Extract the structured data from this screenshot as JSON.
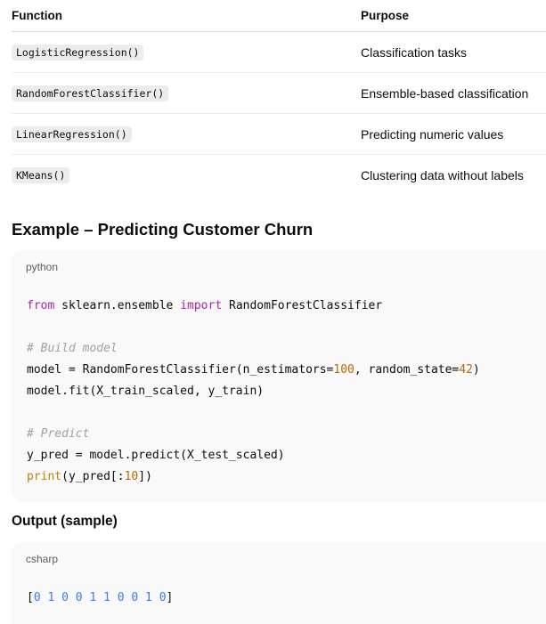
{
  "table": {
    "headers": {
      "function": "Function",
      "purpose": "Purpose"
    },
    "rows": [
      {
        "function": "LogisticRegression()",
        "purpose": "Classification tasks"
      },
      {
        "function": "RandomForestClassifier()",
        "purpose": "Ensemble-based classification"
      },
      {
        "function": "LinearRegression()",
        "purpose": "Predicting numeric values"
      },
      {
        "function": "KMeans()",
        "purpose": "Clustering data without labels"
      }
    ]
  },
  "example": {
    "heading": "Example – Predicting Customer Churn",
    "language": "python",
    "code": {
      "l1_kw1": "from",
      "l1_mod": " sklearn.ensemble ",
      "l1_kw2": "import",
      "l1_cls": " RandomForestClassifier",
      "l3_comment": "# Build model",
      "l4_a": "model = RandomForestClassifier(n_estimators=",
      "l4_n1": "100",
      "l4_b": ", random_state=",
      "l4_n2": "42",
      "l4_c": ")",
      "l5": "model.fit(X_train_scaled, y_train)",
      "l7_comment": "# Predict",
      "l8": "y_pred = model.predict(X_test_scaled)",
      "l9_fn": "print",
      "l9_a": "(y_pred[:",
      "l9_n": "10",
      "l9_b": "])"
    }
  },
  "output": {
    "heading": "Output (sample)",
    "language": "csharp",
    "open": "[",
    "values": "0 1 0 0 1 1 0 0 1 0",
    "close": "]"
  },
  "colors": {
    "keyword": "#a626a4",
    "comment": "#a0a1a7",
    "number": "#b76b01",
    "builtin": "#c18401",
    "array_values": "#4078f2"
  }
}
